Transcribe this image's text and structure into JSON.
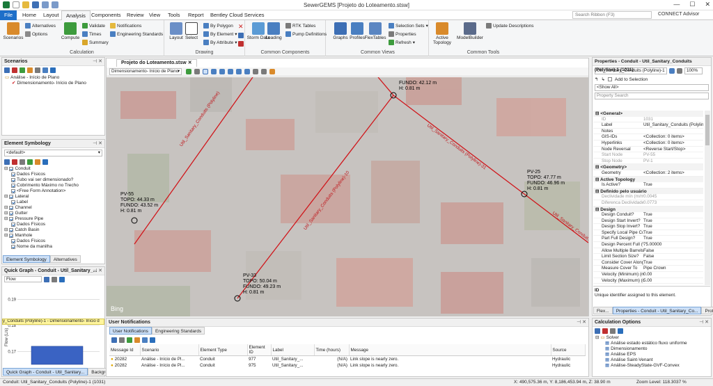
{
  "window": {
    "title": "SewerGEMS [Projeto do Loteamento.stsw]"
  },
  "colors": {
    "file_tab": "#1e6fc9",
    "conduit": "#d0161b",
    "active_tab": "#cde0f7"
  },
  "tabs": [
    "File",
    "Home",
    "Layout",
    "Analysis",
    "Components",
    "Review",
    "View",
    "Tools",
    "Report",
    "Bentley Cloud Services"
  ],
  "active_tab": "Analysis",
  "ribbon": {
    "search_placeholder": "Search Ribbon (F3)",
    "connect": "CONNECT Advisor",
    "calculation": {
      "label": "Calculation",
      "scenarios": "Scenarios",
      "alternatives": "Alternatives",
      "options": "Options",
      "compute": "Compute",
      "validate": "Validate",
      "times": "Times",
      "summary": "Summary",
      "notifications": "Notifications",
      "engineering_standards": "Engineering Standards"
    },
    "drawing": {
      "label": "Drawing",
      "layout": "Layout",
      "select": "Select",
      "by_polygon": "By Polygon",
      "by_element": "By Element",
      "by_attribute": "By Attribute"
    },
    "common_components": {
      "label": "Common Components",
      "storm_data": "Storm Data",
      "loading": "Loading",
      "rtk_tables": "RTK Tables",
      "pump_definitions": "Pump Definitions"
    },
    "common_views": {
      "label": "Common Views",
      "graphs": "Graphs",
      "profiles": "Profiles",
      "flextables": "FlexTables",
      "selection_sets": "Selection Sets",
      "properties": "Properties",
      "refresh": "Refresh"
    },
    "common_tools": {
      "label": "Common Tools",
      "active_topology": "Active Topology",
      "modelbuilder": "ModelBuilder",
      "update_descriptions": "Update Descriptions"
    }
  },
  "scenarios": {
    "title": "Scenarios",
    "items": [
      "Análise - Início de Plano",
      "Dimensionamento- Início de Plano"
    ]
  },
  "symbology": {
    "title": "Element Symbology",
    "filter": "<default>",
    "items": [
      {
        "label": "Conduit",
        "level": 0
      },
      {
        "label": "Dados Físicos",
        "level": 1
      },
      {
        "label": "Tubo vai ser dimensionado?",
        "level": 1
      },
      {
        "label": "Cobrimento Máximo no Trecho",
        "level": 1
      },
      {
        "label": "<Free Form Annotation>",
        "level": 1
      },
      {
        "label": "Lateral",
        "level": 0
      },
      {
        "label": "Label",
        "level": 1
      },
      {
        "label": "Channel",
        "level": 0
      },
      {
        "label": "Gutter",
        "level": 0
      },
      {
        "label": "Pressure Pipe",
        "level": 0
      },
      {
        "label": "Dados Físicos",
        "level": 1
      },
      {
        "label": "Catch Basin",
        "level": 0
      },
      {
        "label": "Manhole",
        "level": 0
      },
      {
        "label": "Dados Físicos",
        "level": 1
      },
      {
        "label": "Nome da manilha",
        "level": 1
      }
    ],
    "tabs": [
      "Element Symbology",
      "Alternatives"
    ]
  },
  "quick_graph": {
    "title": "Quick Graph - Conduit - Util_Sanitary_...",
    "field": "Flow",
    "series_label": "y_Conduits (Polyline)-1 - Dimensionamento- Início d",
    "ylabel": "Flow (L/s)",
    "tabs": [
      "Quick Graph - Conduit - Util_Sanitary...",
      "Backgro..."
    ]
  },
  "chart_data": {
    "type": "bar",
    "categories": [
      ""
    ],
    "values": [
      0.172
    ],
    "ylabel": "Flow (L/s)",
    "yticks": [
      0.17,
      0.18,
      0.19
    ],
    "ylim": [
      0.165,
      0.195
    ]
  },
  "document": {
    "tab": "Projeto do Loteamento.stsw",
    "scenario": "Dimensionamento- Início de Plano",
    "bing": "Bing",
    "nodes": [
      {
        "name": "PV-55",
        "topo": "TOPO: 44.33 m",
        "fundo": "FUNDO: 43.52 m",
        "h": "H: 0.81 m"
      },
      {
        "name": "PV-25",
        "topo": "TOPO: 47.77 m",
        "fundo": "FUNDO: 46.96 m",
        "h": "H: 0.81 m"
      },
      {
        "name": "PV-33",
        "topo": "TOPO: 50.04 m",
        "fundo": "FUNDO: 49.23 m",
        "h": "H: 0.81 m"
      },
      {
        "name": "",
        "topo": "",
        "fundo": "FUNDO: 42.12 m",
        "h": "H: 0.81 m"
      }
    ],
    "conduit_labels": [
      "Util_Sanitary_Conduits (Polyline)",
      "Util_Sanitary_Conduits (Polyline)-31",
      "Util_Sanitary_Conduits (Polyline)-10",
      "Util_Sanitary_Conduits"
    ]
  },
  "properties": {
    "title": "Properties - Conduit - Util_Sanitary_Conduits (Polyline)-1 (1031)",
    "selector": "Util_Sanitary_Conduits (Polyline)-1",
    "zoom": "100%",
    "add_to_selection": "Add to Selection",
    "show": "<Show All>",
    "search_placeholder": "Property Search",
    "rows": [
      {
        "cat": "<General>"
      },
      {
        "k": "ID",
        "v": "1031",
        "ro": true
      },
      {
        "k": "Label",
        "v": "Util_Sanitary_Conduits (Polyline"
      },
      {
        "k": "Notes",
        "v": ""
      },
      {
        "k": "GIS-IDs",
        "v": "<Collection: 0 items>"
      },
      {
        "k": "Hyperlinks",
        "v": "<Collection: 0 items>"
      },
      {
        "k": "Node Reversal",
        "v": "<Reverse Start/Stop>"
      },
      {
        "k": "Start Node",
        "v": "PV-55",
        "ro": true
      },
      {
        "k": "Stop Node",
        "v": "PV-1",
        "ro": true
      },
      {
        "cat": "<Geometry>"
      },
      {
        "k": "Geometry",
        "v": "<Collection: 2 items>"
      },
      {
        "cat": "Active Topology"
      },
      {
        "k": "Is Active?",
        "v": "True"
      },
      {
        "cat": "Definido pelo usuário"
      },
      {
        "k": "Declividade mín (m/m)",
        "v": "0.0045",
        "ro": true
      },
      {
        "k": "Diferenca Declividade (m",
        "v": "0.0773",
        "ro": true
      },
      {
        "cat": "Design"
      },
      {
        "k": "Design Conduit?",
        "v": "True"
      },
      {
        "k": "Design Start Invert?",
        "v": "True"
      },
      {
        "k": "Design Stop Invert?",
        "v": "True"
      },
      {
        "k": "Specify Local Pipe Constr",
        "v": "True"
      },
      {
        "k": "Part Full Design?",
        "v": "True"
      },
      {
        "k": "Design Percent Full (%)",
        "v": "75.00000"
      },
      {
        "k": "Allow Multiple Barrels?",
        "v": "False"
      },
      {
        "k": "Limit Section Size?",
        "v": "False"
      },
      {
        "k": "Consider Cover Along Pip",
        "v": "True"
      },
      {
        "k": "Measure Cover To",
        "v": "Pipe Crown"
      },
      {
        "k": "Velocity (Minimum) (m/s)",
        "v": "0.00"
      },
      {
        "k": "Velocity (Maximum) (m/s)",
        "v": "5.00"
      }
    ],
    "desc_title": "ID",
    "desc_text": "Unique identifier assigned to this element.",
    "tabs": [
      "Flex...",
      "Properties - Conduit - Util_Sanitary_Co...",
      "Prot..."
    ]
  },
  "calc_options": {
    "title": "Calculation Options",
    "root": "Solver",
    "items": [
      "Análise estado estático fluxo uniforme",
      "Dimensionamento",
      "Análise EPS",
      "Análise Saint-Venant",
      "Análise-SteadyState-GVF-Convex"
    ]
  },
  "notifications": {
    "title": "User Notifications",
    "tabs": [
      "User Notifications",
      "Engineering Standards"
    ],
    "columns": [
      "Message Id",
      "Scenario",
      "Element Type",
      "Element ID",
      "Label",
      "Time (hours)",
      "Message",
      "Source"
    ],
    "rows": [
      [
        "20282",
        "Análise - Início de Pl...",
        "Conduit",
        "977",
        "Util_Sanitary_...",
        "(N/A)",
        "Link slope is nearly zero.",
        "Hydraulic"
      ],
      [
        "20282",
        "Análise - Início de Pl...",
        "Conduit",
        "975",
        "Util_Sanitary_...",
        "(N/A)",
        "Link slope is nearly zero.",
        "Hydraulic"
      ]
    ]
  },
  "status": {
    "left": "Conduit: Util_Sanitary_Conduits (Polyline)-1 (1031)",
    "coords": "X: 490,575.36 m, Y: 8,186,453.94 m, Z: 38.90 m",
    "zoom": "Zoom Level: 118.3037 %"
  }
}
